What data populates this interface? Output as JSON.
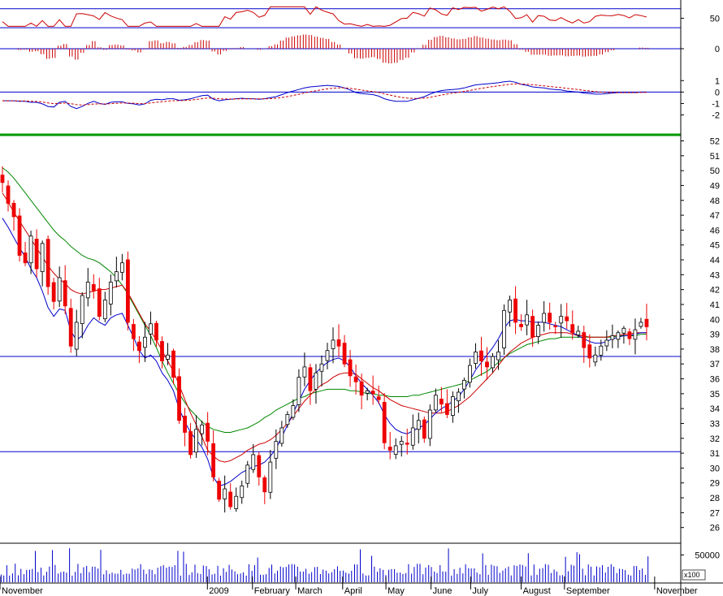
{
  "chart_data": {
    "type": "candlestick",
    "months": [
      "November",
      "2009",
      "February",
      "March",
      "April",
      "May",
      "June",
      "July",
      "August",
      "September",
      "November"
    ],
    "month_positions": [
      0,
      11.5,
      14,
      16.4,
      19,
      21.4,
      23.9,
      26.1,
      28.9,
      31.3,
      36.3
    ],
    "months_x_comment": "",
    "price": {
      "yticks": [
        26,
        27,
        28,
        29,
        30,
        31,
        32,
        33,
        34,
        35,
        36,
        37,
        38,
        39,
        40,
        41,
        42,
        43,
        44,
        45,
        46,
        47,
        48,
        49,
        50,
        51,
        52
      ],
      "ylim": [
        25,
        52.3
      ],
      "hlines": [
        37.5,
        31.1
      ],
      "closes": [
        49.2,
        47.8,
        46.9,
        44.3,
        43.8,
        45.6,
        43.4,
        45.1,
        42.2,
        41.2,
        42.8,
        40.9,
        38.2,
        39.8,
        41.6,
        42.5,
        41.9,
        40.2,
        41.3,
        42.5,
        43.2,
        43.8,
        39.8,
        38.7,
        37.9,
        38.8,
        39.7,
        38.6,
        37.2,
        37.6,
        36.1,
        33.2,
        32.4,
        30.9,
        32.6,
        32.9,
        31.8,
        29.4,
        27.9,
        28.6,
        27.4,
        28.1,
        28.8,
        30.2,
        30.9,
        29.4,
        28.4,
        30.4,
        31.8,
        32.7,
        33.6,
        34.2,
        36.1,
        36.8,
        35.2,
        36.4,
        37.0,
        37.9,
        38.6,
        38.2,
        37.0,
        36.2,
        35.8,
        34.9,
        35.2,
        35.0,
        34.6,
        31.7,
        31.2,
        31.5,
        31.8,
        31.6,
        32.7,
        33.2,
        32.0,
        33.9,
        34.9,
        34.3,
        33.6,
        34.8,
        35.1,
        35.9,
        36.9,
        37.8,
        37.2,
        36.8,
        37.5,
        37.8,
        40.6,
        41.3,
        39.8,
        39.5,
        40.3,
        38.8,
        39.6,
        40.4,
        39.8,
        39.5,
        40.2,
        39.9,
        39.1,
        39.2,
        38.1,
        37.4,
        37.6,
        38.2,
        38.6,
        38.9,
        39.1,
        39.4,
        38.7,
        39.3,
        39.8,
        39.5
      ],
      "sma_fast_blue": [
        46.8,
        46.2,
        45.5,
        44.8,
        44.2,
        43.4,
        42.8,
        41.9,
        40.8,
        40.2,
        40.7,
        40.6,
        39.2,
        38.6,
        38.9,
        39.6,
        40.1,
        39.8,
        39.6,
        40.1,
        40.3,
        40.4,
        39.6,
        38.8,
        37.9,
        37.4,
        37.6,
        37.2,
        36.4,
        35.9,
        35.2,
        34.0,
        33.1,
        32.4,
        31.9,
        31.4,
        30.6,
        29.4,
        28.8,
        28.9,
        29.1,
        29.4,
        29.7,
        29.9,
        30.1,
        30.2,
        30.4,
        30.8,
        31.3,
        32.1,
        32.9,
        33.7,
        34.5,
        35.3,
        35.9,
        36.4,
        36.8,
        37.1,
        37.3,
        37.4,
        37.2,
        36.8,
        36.2,
        35.7,
        35.3,
        34.9,
        34.4,
        33.6,
        33.0,
        32.6,
        32.4,
        32.3,
        32.5,
        32.7,
        32.9,
        33.3,
        33.7,
        34.0,
        34.2,
        34.5,
        34.8,
        35.3,
        35.9,
        36.6,
        37.1,
        37.6,
        38.1,
        38.7,
        39.4,
        39.9,
        40.0,
        39.9,
        39.9,
        39.8,
        39.8,
        39.8,
        39.7,
        39.6,
        39.5,
        39.3,
        39.1,
        38.9,
        38.7,
        38.5,
        38.4,
        38.4,
        38.5,
        38.7,
        38.8,
        38.9,
        38.9,
        39.0,
        39.1,
        39.1
      ],
      "sma_mid_red": [
        48.5,
        47.9,
        47.2,
        46.6,
        46.0,
        45.4,
        44.8,
        44.2,
        43.6,
        43.1,
        42.7,
        42.4,
        42.0,
        41.8,
        41.7,
        41.8,
        41.9,
        42.0,
        42.0,
        42.1,
        42.2,
        42.3,
        41.8,
        41.1,
        40.4,
        39.7,
        39.2,
        38.6,
        37.9,
        37.2,
        36.5,
        35.6,
        34.6,
        33.7,
        32.9,
        32.1,
        31.2,
        30.8,
        30.5,
        30.4,
        30.5,
        30.7,
        30.9,
        31.2,
        31.4,
        31.6,
        31.7,
        31.9,
        32.2,
        32.6,
        33.0,
        33.5,
        34.0,
        34.5,
        34.9,
        35.3,
        35.6,
        35.8,
        36.1,
        36.3,
        36.4,
        36.4,
        36.3,
        36.0,
        35.7,
        35.4,
        35.2,
        34.9,
        34.6,
        34.4,
        34.2,
        34.1,
        34.0,
        33.9,
        33.8,
        33.7,
        33.7,
        33.7,
        33.8,
        34.0,
        34.2,
        34.5,
        34.8,
        35.2,
        35.6,
        36.0,
        36.4,
        36.9,
        37.4,
        37.8,
        38.1,
        38.4,
        38.6,
        38.8,
        38.9,
        39.0,
        39.1,
        39.1,
        39.1,
        39.1,
        39.0,
        38.9,
        38.9,
        38.8,
        38.8,
        38.8,
        38.8,
        38.9,
        38.9,
        39.0,
        39.0,
        39.1,
        39.1,
        39.1
      ],
      "sma_slow_green": [
        50.2,
        49.9,
        49.5,
        49.0,
        48.5,
        48.0,
        47.5,
        47.0,
        46.5,
        46.0,
        45.6,
        45.3,
        44.9,
        44.6,
        44.3,
        44.1,
        44.0,
        43.8,
        43.5,
        43.2,
        42.8,
        42.3,
        41.7,
        41.0,
        40.3,
        39.6,
        38.9,
        38.1,
        37.2,
        36.4,
        35.7,
        35.0,
        34.4,
        33.9,
        33.5,
        33.1,
        32.8,
        32.6,
        32.5,
        32.4,
        32.4,
        32.5,
        32.6,
        32.7,
        32.9,
        33.1,
        33.4,
        33.6,
        33.9,
        34.1,
        34.3,
        34.5,
        34.7,
        34.8,
        35.0,
        35.1,
        35.2,
        35.3,
        35.3,
        35.3,
        35.3,
        35.2,
        35.2,
        35.1,
        35.0,
        35.0,
        34.9,
        34.9,
        34.8,
        34.8,
        34.8,
        34.8,
        34.9,
        34.9,
        35.0,
        35.1,
        35.2,
        35.3,
        35.4,
        35.5,
        35.6,
        35.7,
        35.9,
        36.1,
        36.3,
        36.5,
        36.8,
        37.1,
        37.4,
        37.7,
        37.9,
        38.1,
        38.3,
        38.4,
        38.5,
        38.6,
        38.7,
        38.7,
        38.8,
        38.8,
        38.8,
        38.8,
        38.8,
        38.8,
        38.8,
        38.8,
        38.8,
        38.8,
        38.9,
        38.9,
        38.9,
        38.9,
        39.0,
        39.0
      ]
    },
    "rsi": {
      "yticks": [
        50
      ],
      "ylim": [
        20,
        85
      ],
      "hlines": [
        70,
        30
      ]
    },
    "macd_hist": {
      "yticks": [
        0
      ],
      "ylim": [
        -1,
        1
      ]
    },
    "macd_lines": {
      "yticks": [
        1,
        0,
        -1,
        -2
      ],
      "ylim": [
        -2.6,
        1.8
      ]
    },
    "volume": {
      "ytick_label": "50000",
      "multiplier": "x100",
      "ylim": [
        0,
        70000
      ]
    }
  }
}
